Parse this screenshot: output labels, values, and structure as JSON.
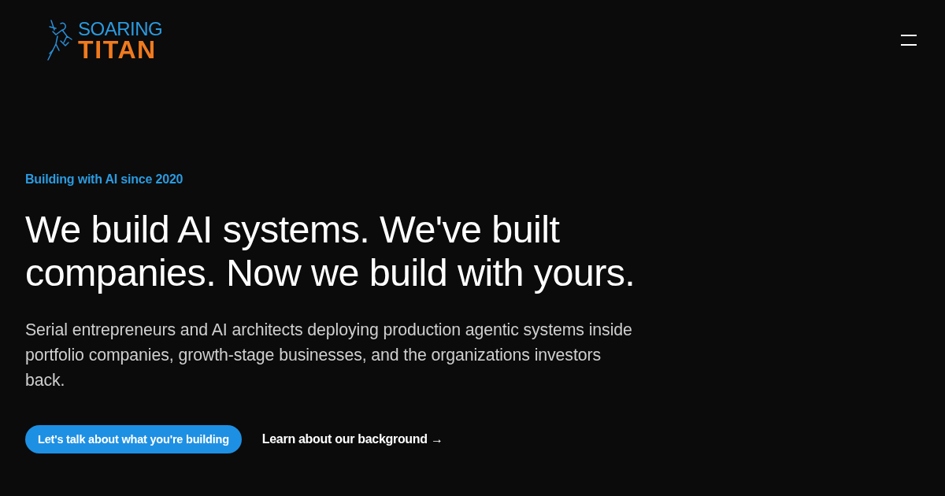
{
  "header": {
    "logo": {
      "line_1": "SOARING",
      "line_2": "TITAN"
    }
  },
  "hero": {
    "eyebrow": "Building with AI since 2020",
    "headline": "We build AI systems. We've built companies. Now we build with yours.",
    "description": "Serial entrepreneurs and AI architects deploying production agentic systems inside portfolio companies, growth-stage businesses, and the organizations investors back.",
    "actions": [
      {
        "kind": "primary",
        "label": "Let's talk about what you're building"
      },
      {
        "kind": "link",
        "label": "Learn about our background →"
      }
    ]
  }
}
